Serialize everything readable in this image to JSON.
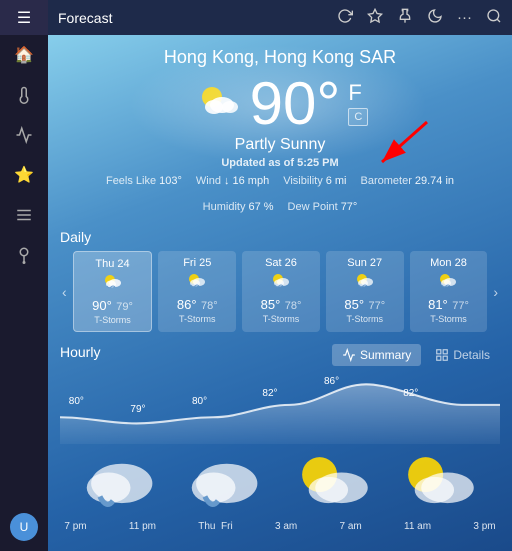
{
  "app": {
    "title": "Forecast",
    "titlebar_buttons": [
      "refresh",
      "star",
      "pin",
      "moon",
      "more",
      "search"
    ]
  },
  "sidebar": {
    "items": [
      {
        "icon": "🏠",
        "name": "home",
        "active": true
      },
      {
        "icon": "🌡",
        "name": "temperature"
      },
      {
        "icon": "📊",
        "name": "chart"
      },
      {
        "icon": "⭐",
        "name": "favorites"
      },
      {
        "icon": "☰",
        "name": "menu"
      },
      {
        "icon": "😊",
        "name": "notifications"
      }
    ]
  },
  "weather": {
    "city": "Hong Kong, Hong Kong SAR",
    "temperature": "90°",
    "unit_f": "F",
    "unit_c": "C",
    "condition": "Partly Sunny",
    "updated": "Updated as of 5:25 PM",
    "feels_like": "103°",
    "wind": "↓ 16 mph",
    "visibility": "6 mi",
    "barometer": "29.74 in",
    "humidity": "67 %",
    "dew_point": "77°"
  },
  "daily": {
    "title": "Daily",
    "days": [
      {
        "name": "Thu 24",
        "hi": "90°",
        "lo": "79°",
        "condition": "T-Storms",
        "active": true
      },
      {
        "name": "Fri 25",
        "hi": "86°",
        "lo": "78°",
        "condition": "T-Storms"
      },
      {
        "name": "Sat 26",
        "hi": "85°",
        "lo": "78°",
        "condition": "T-Storms"
      },
      {
        "name": "Sun 27",
        "hi": "85°",
        "lo": "77°",
        "condition": "T-Storms"
      },
      {
        "name": "Mon 28",
        "hi": "81°",
        "lo": "77°",
        "condition": "T-Storms"
      }
    ]
  },
  "hourly": {
    "title": "Hourly",
    "tab_summary": "Summary",
    "tab_details": "Details",
    "times": [
      "7 pm",
      "11 pm",
      "Thu  Fri",
      "3 am",
      "7 am",
      "11 am",
      "3 pm"
    ],
    "temps": [
      80,
      79,
      80,
      82,
      86,
      82
    ],
    "temp_labels": [
      {
        "value": "80°",
        "x": 2
      },
      {
        "value": "79°",
        "x": 16
      },
      {
        "value": "80°",
        "x": 30
      },
      {
        "value": "82°",
        "x": 46
      },
      {
        "value": "86°",
        "x": 60
      },
      {
        "value": "82°",
        "x": 78
      }
    ]
  }
}
